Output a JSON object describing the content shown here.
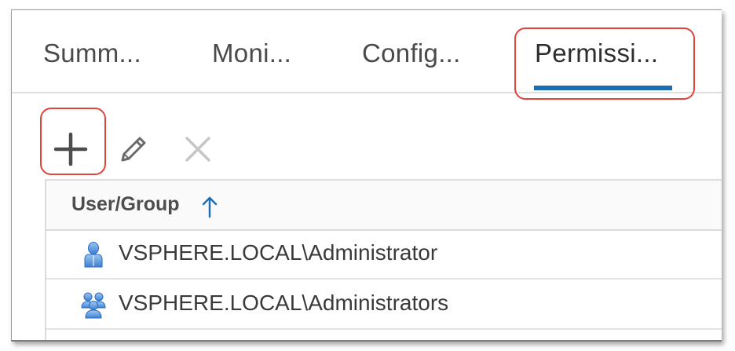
{
  "tabs": [
    {
      "label": "Summ..."
    },
    {
      "label": "Moni..."
    },
    {
      "label": "Config..."
    },
    {
      "label": "Permissi...",
      "active": true
    }
  ],
  "toolbar": {
    "add_icon": "plus-icon",
    "edit_icon": "pencil-icon",
    "delete_icon": "x-icon",
    "delete_enabled": false
  },
  "grid": {
    "columns": [
      {
        "label": "User/Group",
        "sort": "ascending"
      }
    ],
    "rows": [
      {
        "icon": "user-icon",
        "name": "VSPHERE.LOCAL\\Administrator"
      },
      {
        "icon": "group-icon",
        "name": "VSPHERE.LOCAL\\Administrators"
      }
    ]
  },
  "colors": {
    "accent": "#1d6fb3",
    "highlight": "#e0443a",
    "icon_blue": "#4a8ad8"
  }
}
